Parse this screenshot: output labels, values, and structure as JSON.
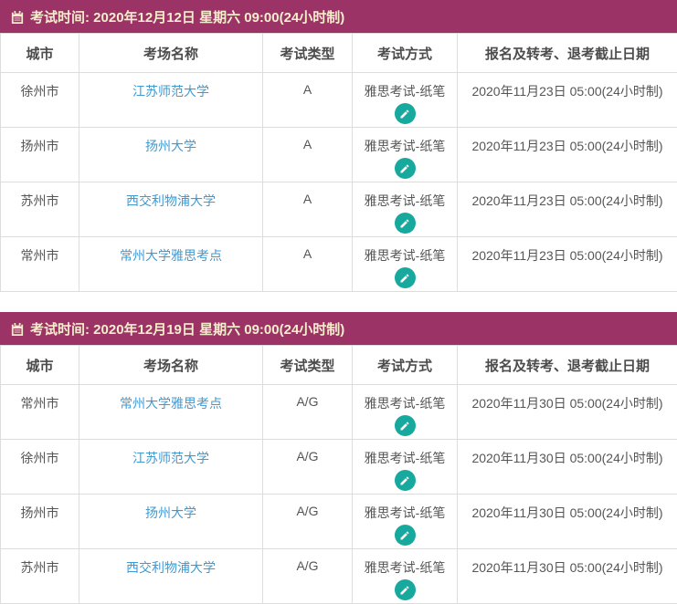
{
  "columns": [
    "城市",
    "考场名称",
    "考试类型",
    "考试方式",
    "报名及转考、退考截止日期"
  ],
  "colors": {
    "session_header_bg": "#9b3367",
    "session_header_text": "#f5eecb",
    "venue_link": "#3e9ad3",
    "edit_icon_bg": "#17a89e",
    "table_border": "#dddddd",
    "cell_text": "#555555"
  },
  "icons": {
    "calendar": "calendar-icon",
    "edit": "pencil-icon"
  },
  "sections": [
    {
      "title": "考试时间: 2020年12月12日 星期六 09:00(24小时制)",
      "rows": [
        {
          "city": "徐州市",
          "venue": "江苏师范大学",
          "type": "A",
          "method": "雅思考试-纸笔",
          "deadline": "2020年11月23日 05:00(24小时制)"
        },
        {
          "city": "扬州市",
          "venue": "扬州大学",
          "type": "A",
          "method": "雅思考试-纸笔",
          "deadline": "2020年11月23日 05:00(24小时制)"
        },
        {
          "city": "苏州市",
          "venue": "西交利物浦大学",
          "type": "A",
          "method": "雅思考试-纸笔",
          "deadline": "2020年11月23日 05:00(24小时制)"
        },
        {
          "city": "常州市",
          "venue": "常州大学雅思考点",
          "type": "A",
          "method": "雅思考试-纸笔",
          "deadline": "2020年11月23日 05:00(24小时制)"
        }
      ]
    },
    {
      "title": "考试时间: 2020年12月19日 星期六 09:00(24小时制)",
      "rows": [
        {
          "city": "常州市",
          "venue": "常州大学雅思考点",
          "type": "A/G",
          "method": "雅思考试-纸笔",
          "deadline": "2020年11月30日 05:00(24小时制)"
        },
        {
          "city": "徐州市",
          "venue": "江苏师范大学",
          "type": "A/G",
          "method": "雅思考试-纸笔",
          "deadline": "2020年11月30日 05:00(24小时制)"
        },
        {
          "city": "扬州市",
          "venue": "扬州大学",
          "type": "A/G",
          "method": "雅思考试-纸笔",
          "deadline": "2020年11月30日 05:00(24小时制)"
        },
        {
          "city": "苏州市",
          "venue": "西交利物浦大学",
          "type": "A/G",
          "method": "雅思考试-纸笔",
          "deadline": "2020年11月30日 05:00(24小时制)"
        }
      ]
    }
  ]
}
